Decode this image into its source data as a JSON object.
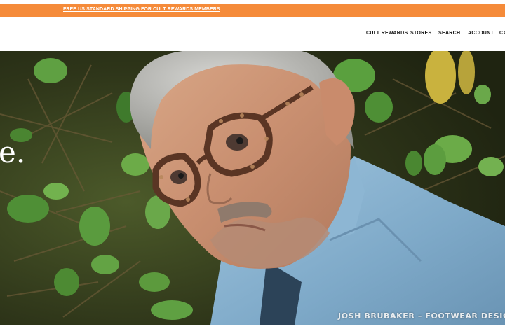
{
  "promo": {
    "text": "FREE US STANDARD SHIPPING FOR CULT REWARDS MEMBERS"
  },
  "nav": {
    "items": [
      {
        "label": "CULT REWARDS"
      },
      {
        "label": "STORES"
      },
      {
        "label": "SEARCH"
      },
      {
        "label": "ACCOUNT"
      },
      {
        "label": "CA"
      }
    ]
  },
  "hero": {
    "headline_fragment": "e.",
    "caption": "JOSH BRUBAKER – FOOTWEAR DESIGNER"
  },
  "colors": {
    "promo_bar": "#f58b3a",
    "nav_text": "#111111",
    "caption_text": "#e8ecef"
  }
}
